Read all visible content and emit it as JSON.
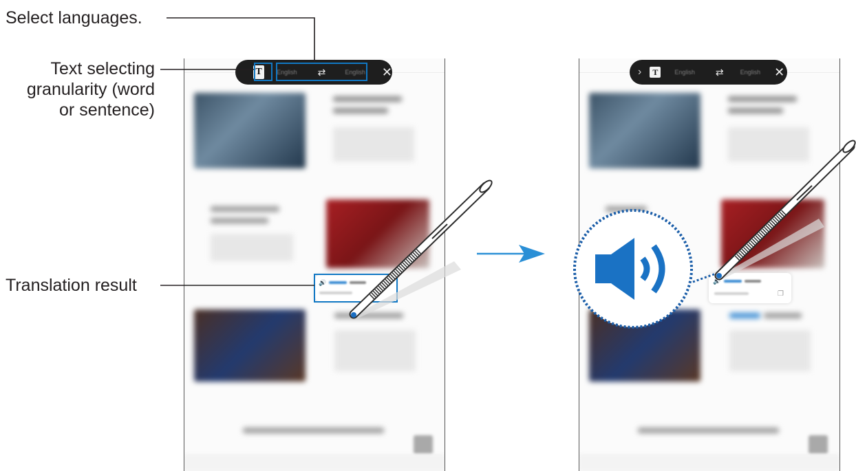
{
  "callouts": {
    "select_languages": "Select languages.",
    "granularity_line1": "Text selecting",
    "granularity_line2": "granularity (word",
    "granularity_line3": "or sentence)",
    "translation_result": "Translation result"
  },
  "toolbar": {
    "text_mode_label": "T",
    "source_language": "English",
    "target_language": "English",
    "swap_icon": "swap-arrows-icon",
    "close_icon": "close-icon",
    "expand_icon": "chevron-right-icon"
  },
  "translation_popup": {
    "speaker_icon": "speaker-icon",
    "copy_icon": "copy-icon"
  },
  "colors": {
    "accent": "#1178c4",
    "zoom_icon_blue": "#1a72c4",
    "toolbar_bg": "#1e1e1e",
    "arrow_blue": "#2a8fd6"
  }
}
